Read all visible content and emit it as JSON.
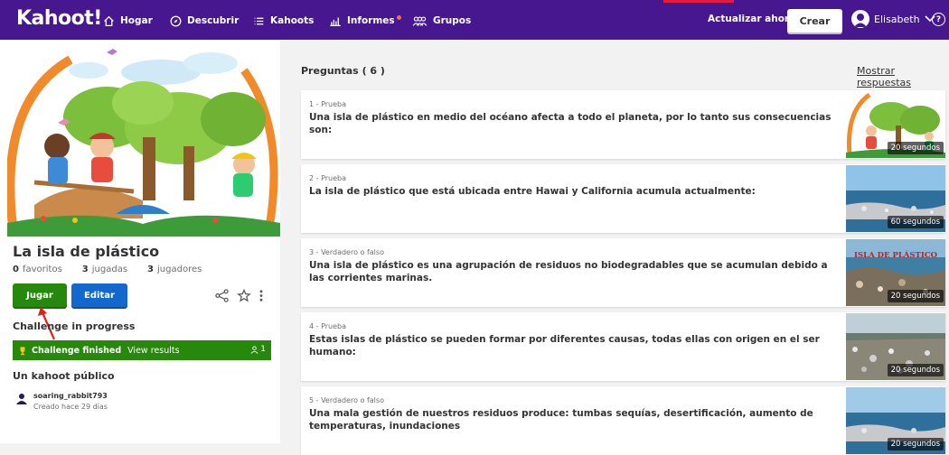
{
  "header": {
    "logo": "Kahoot!",
    "nav": [
      {
        "label": "Hogar",
        "icon": "home-icon"
      },
      {
        "label": "Descubrir",
        "icon": "compass-icon"
      },
      {
        "label": "Kahoots",
        "icon": "list-icon"
      },
      {
        "label": "Informes",
        "icon": "bar-chart-icon"
      },
      {
        "label": "Grupos",
        "icon": "group-icon"
      }
    ],
    "upgrade_label": "Actualizar ahora",
    "create_label": "Crear",
    "user_name": "Elisabeth",
    "help_icon": "help-icon",
    "colors": {
      "bar": "#46178f",
      "notification": "#ff6b3d"
    }
  },
  "kahoot": {
    "title": "La isla de plástico",
    "stats": {
      "favorites_count": "0",
      "favorites_label": "favoritos",
      "plays_count": "3",
      "plays_label": "jugadas",
      "players_count": "3",
      "players_label": "jugadores"
    },
    "play_label": "Jugar",
    "edit_label": "Editar",
    "challenge_heading": "Challenge in progress",
    "challenge_finished": "Challenge finished",
    "view_results": "View results",
    "challenge_participants": "1",
    "visibility_heading": "Un kahoot público",
    "creator_name": "soaring_rabbit793",
    "created": "Creado hace 29 días"
  },
  "questions": {
    "heading": "Preguntas",
    "count": "( 6 )",
    "show_answers": "Mostrar respuestas",
    "items": [
      {
        "type": "1 - Prueba",
        "text": "Una isla de plástico en medio del océano afecta a todo el planeta, por lo tanto sus consecuencias son:",
        "time": "20 segundos"
      },
      {
        "type": "2 - Prueba",
        "text": "La isla de plástico que está ubicada entre Hawai y California acumula actualmente:",
        "time": "60 segundos"
      },
      {
        "type": "3 - Verdadero o falso",
        "text": "Una isla de plástico es una agrupación de residuos no biodegradables que se acumulan debido a las corrientes marinas.",
        "time": "20 segundos",
        "thumb_caption": "ISLA DE PLÁSTICO"
      },
      {
        "type": "4 - Prueba",
        "text": "Estas islas de plástico se pueden formar por diferentes causas, todas ellas con origen en el ser humano:",
        "time": "20 segundos"
      },
      {
        "type": "5 - Verdadero o falso",
        "text": "Una mala gestión de nuestros residuos produce: tumbas sequías, desertificación, aumento de temperaturas, inundaciones",
        "time": "20 segundos"
      }
    ]
  }
}
